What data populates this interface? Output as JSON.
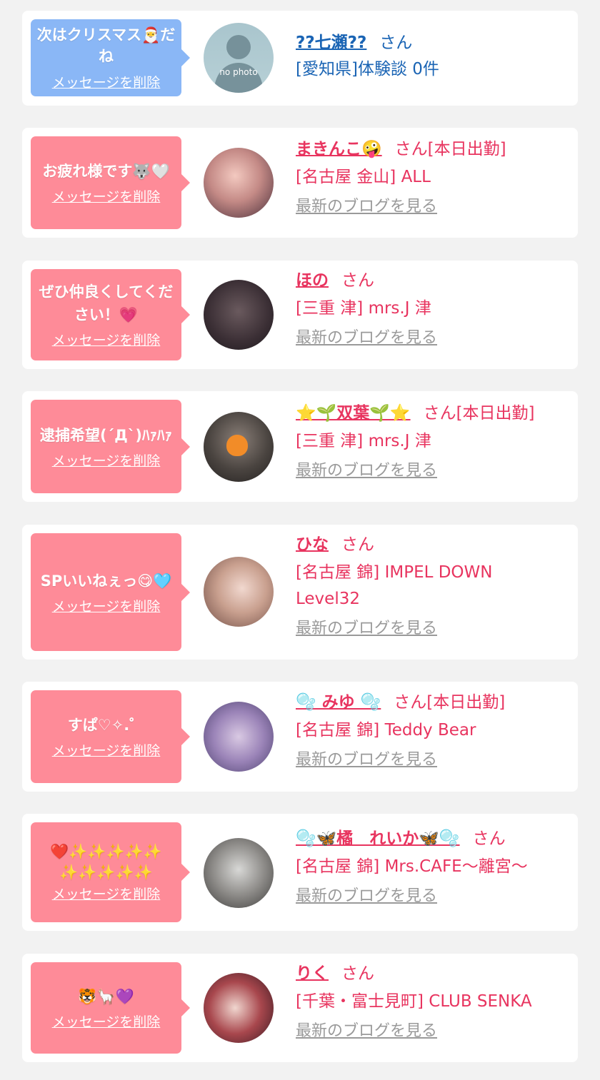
{
  "cards": [
    {
      "bubble_color": "#8ab7f6",
      "message": "次はクリスマス🎅だね",
      "delete_label": "メッセージを削除",
      "name": "??七瀬??",
      "honorific": "さん",
      "status": "",
      "line2": "[愛知県]体験談 0件",
      "blog_label": "",
      "avatar_label": "no photo",
      "name_color": "#1a64b4"
    },
    {
      "bubble_color": "#fe8b98",
      "message": "お疲れ様です🐺🤍",
      "delete_label": "メッセージを削除",
      "name": "まきんこ🤪",
      "honorific": "さん",
      "status": "[本日出勤]",
      "line2": "[名古屋 金山] ALL",
      "blog_label": "最新のブログを見る",
      "avatar_label": "",
      "name_color": "#e8345f"
    },
    {
      "bubble_color": "#fe8b98",
      "message": "ぜひ仲良くしてください！💗",
      "delete_label": "メッセージを削除",
      "name": "ほの",
      "honorific": "さん",
      "status": "",
      "line2": "[三重 津] mrs.J 津",
      "blog_label": "最新のブログを見る",
      "avatar_label": "",
      "name_color": "#e8345f"
    },
    {
      "bubble_color": "#fe8b98",
      "message": "逮捕希望(´Д`)ﾊｧﾊｧ",
      "delete_label": "メッセージを削除",
      "name": "⭐🌱双葉🌱⭐",
      "honorific": "さん",
      "status": "[本日出勤]",
      "line2": "[三重 津] mrs.J 津",
      "blog_label": "最新のブログを見る",
      "avatar_label": "",
      "name_color": "#e8345f"
    },
    {
      "bubble_color": "#fe8b98",
      "message": "SPいいねぇっ😋🩵",
      "delete_label": "メッセージを削除",
      "name": "ひな",
      "honorific": "さん",
      "status": "",
      "line2": "[名古屋 錦] IMPEL DOWN Level32",
      "blog_label": "最新のブログを見る",
      "avatar_label": "",
      "name_color": "#e8345f"
    },
    {
      "bubble_color": "#fe8b98",
      "message": "すぱ♡✧.゜",
      "delete_label": "メッセージを削除",
      "name": "🫧 みゆ 🫧",
      "honorific": "さん",
      "status": "[本日出勤]",
      "line2": "[名古屋 錦] Teddy Bear",
      "blog_label": "最新のブログを見る",
      "avatar_label": "",
      "name_color": "#e8345f"
    },
    {
      "bubble_color": "#fe8b98",
      "message": "❤️✨✨✨✨✨✨✨✨✨✨",
      "delete_label": "メッセージを削除",
      "name": "🫧🦋橘　れいか🦋🫧",
      "honorific": "さん",
      "status": "",
      "line2": "[名古屋 錦] Mrs.CAFE〜離宮〜",
      "blog_label": "最新のブログを見る",
      "avatar_label": "",
      "name_color": "#e8345f"
    },
    {
      "bubble_color": "#fe8b98",
      "message": "🐯🦙💜",
      "delete_label": "メッセージを削除",
      "name": "りく",
      "honorific": "さん",
      "status": "",
      "line2": "[千葉・富士見町] CLUB SENKA",
      "blog_label": "最新のブログを見る",
      "avatar_label": "",
      "name_color": "#e8345f"
    }
  ]
}
